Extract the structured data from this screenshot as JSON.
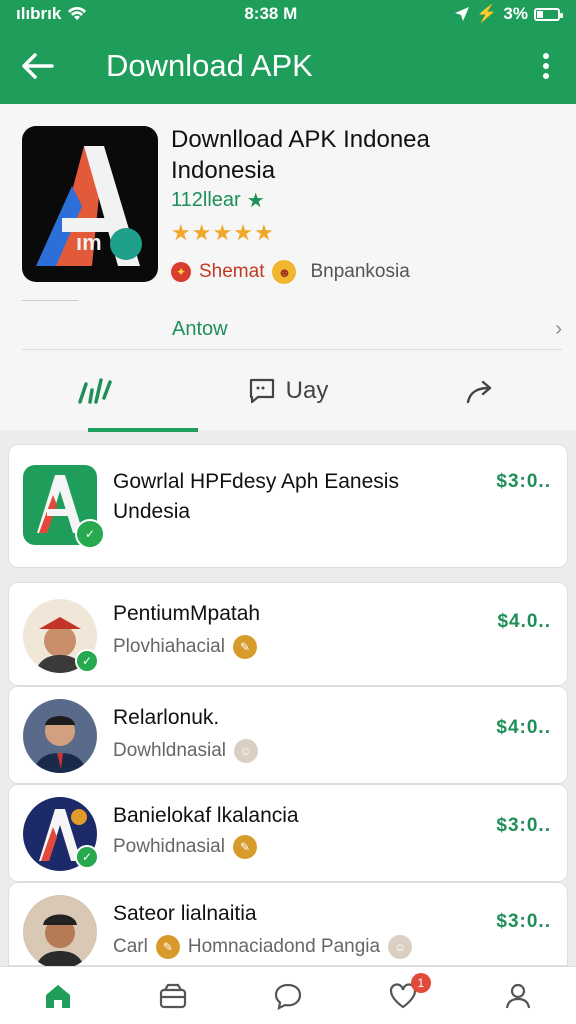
{
  "status_bar": {
    "carrier": "ılıbrık",
    "time": "8:38 M",
    "battery": "3%",
    "battery_level": 0.3
  },
  "app_bar": {
    "title": "Download APK"
  },
  "app": {
    "name_line1": "Downlload APK Indonea",
    "name_line2": "Indonesia",
    "developer": "112llear",
    "rating_stars": 5,
    "badge1": "Shemat",
    "badge2": "Bnpankosia",
    "action_link": "Antow"
  },
  "tabs": [
    {
      "label": "",
      "icon": "chart-icon"
    },
    {
      "label": "Uay",
      "icon": "chat-square-icon"
    },
    {
      "label": "",
      "icon": "share-icon"
    }
  ],
  "list": [
    {
      "title1": "Gowrlal HPFdesy Aph Eanesis",
      "title2": "Undesia",
      "sub": "",
      "price": "$3:0.."
    },
    {
      "title1": "PentiumMpatah",
      "sub": "Plovhiahacial",
      "price": "$4.0.."
    },
    {
      "title1": "Relarlonuk.",
      "sub": "Dowhldnasial",
      "price": "$4:0.."
    },
    {
      "title1": "Banielokaf lkalancia",
      "sub": "Powhidnasial",
      "price": "$3:0.."
    },
    {
      "title1": "Sateor lialnaitia",
      "sub_prefix": "Carl",
      "sub": "Homnaciadond Pangia",
      "price": "$3:0.."
    }
  ],
  "bottom_nav": {
    "notif_count": "1"
  },
  "colors": {
    "primary": "#1e9e5a",
    "price": "#1e8f57",
    "star": "#f0a82a"
  }
}
